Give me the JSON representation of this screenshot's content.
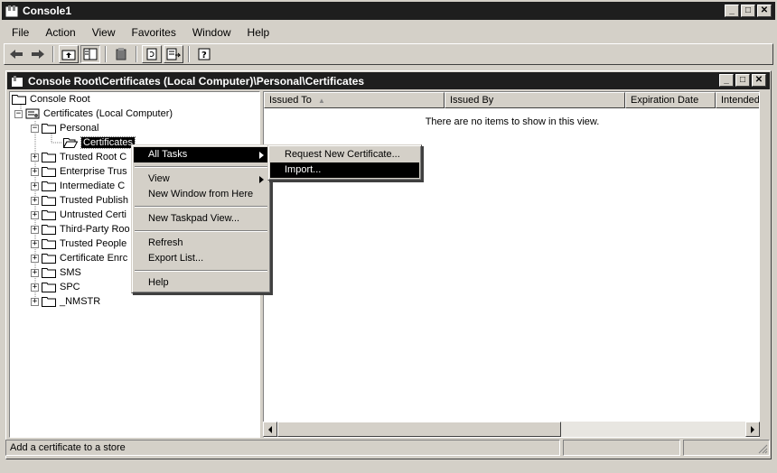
{
  "app": {
    "title": "Console1",
    "child_title": "Console Root\\Certificates (Local Computer)\\Personal\\Certificates"
  },
  "caption_buttons": {
    "minimize": "_",
    "maximize": "□",
    "close": "✕"
  },
  "menubar": [
    {
      "label": "File"
    },
    {
      "label": "Action"
    },
    {
      "label": "View"
    },
    {
      "label": "Favorites"
    },
    {
      "label": "Window"
    },
    {
      "label": "Help"
    }
  ],
  "toolbar": {
    "icons": [
      "back-arrow-icon",
      "forward-arrow-icon",
      "up-folder-icon",
      "show-hide-tree-icon",
      "delete-icon",
      "refresh-icon",
      "export-list-icon",
      "help-icon"
    ]
  },
  "tree": {
    "console_root": "Console Root",
    "certificates_local": "Certificates (Local Computer)",
    "personal": "Personal",
    "certificates": "Certificates",
    "stores": [
      "Trusted Root C",
      "Enterprise Trus",
      "Intermediate C",
      "Trusted Publish",
      "Untrusted Certi",
      "Third-Party Roo",
      "Trusted People",
      "Certificate Enrc",
      "SMS",
      "SPC",
      "_NMSTR"
    ]
  },
  "list": {
    "columns": [
      "Issued To",
      "Issued By",
      "Expiration Date",
      "Intended"
    ],
    "sort_indicator": "▲",
    "empty_message": "There are no items to show in this view."
  },
  "context_menu": {
    "all_tasks": "All Tasks",
    "view": "View",
    "new_window": "New Window from Here",
    "new_taskpad": "New Taskpad View...",
    "refresh": "Refresh",
    "export_list": "Export List...",
    "help": "Help"
  },
  "submenu": {
    "request_new": "Request New Certificate...",
    "import": "Import..."
  },
  "status": {
    "text": "Add a certificate to a store"
  },
  "colors": {
    "face": "#d4d0c8",
    "titlebar": "#1e1e1e",
    "highlight": "#000000"
  }
}
